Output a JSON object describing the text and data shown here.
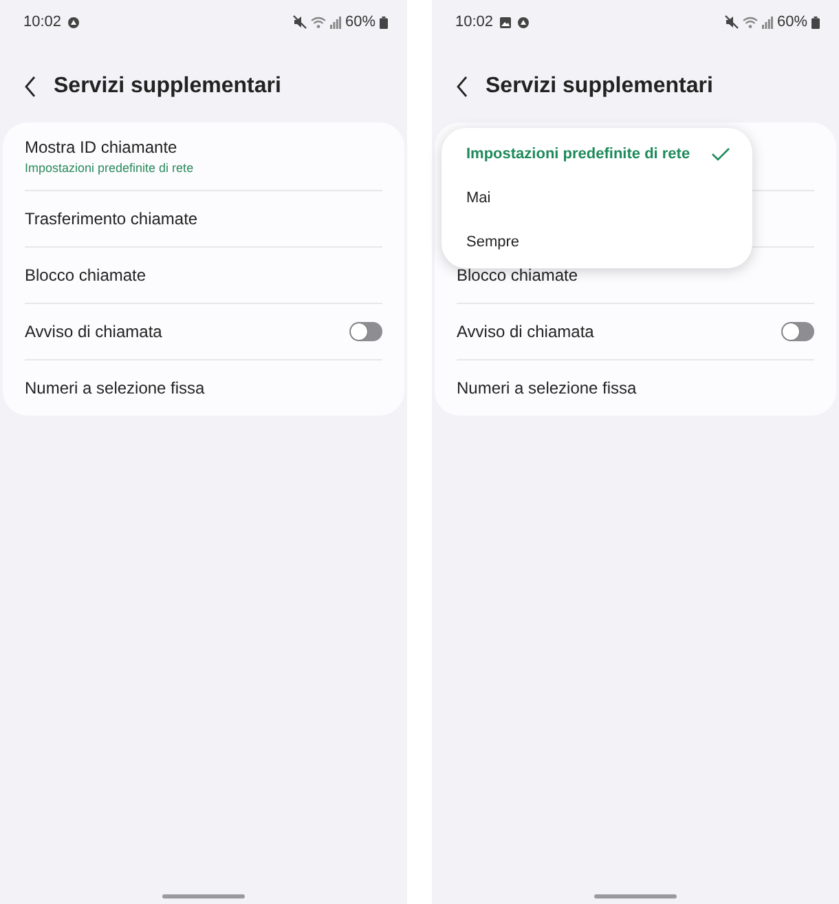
{
  "screens": [
    {
      "status_bar": {
        "time": "10:02",
        "notification_icons": [
          {
            "kind": "badge"
          }
        ],
        "battery": "60%"
      },
      "header": {
        "title": "Servizi supplementari"
      },
      "rows": [
        {
          "kind": "text",
          "label": "Mostra ID chiamante",
          "subtitle": "Impostazioni predefinite di rete"
        },
        {
          "kind": "text",
          "label": "Trasferimento chiamate"
        },
        {
          "kind": "text",
          "label": "Blocco chiamate"
        },
        {
          "kind": "switch",
          "label": "Avviso di chiamata",
          "on": false
        },
        {
          "kind": "text",
          "label": "Numeri a selezione fissa"
        }
      ]
    },
    {
      "status_bar": {
        "time": "10:02",
        "notification_icons": [
          {
            "kind": "image"
          },
          {
            "kind": "badge"
          }
        ],
        "battery": "60%"
      },
      "header": {
        "title": "Servizi supplementari"
      },
      "rows": [
        {
          "kind": "covered",
          "tall": true
        },
        {
          "kind": "covered"
        },
        {
          "kind": "text",
          "label": "Blocco chiamate"
        },
        {
          "kind": "switch",
          "label": "Avviso di chiamata",
          "on": false
        },
        {
          "kind": "text",
          "label": "Numeri a selezione fissa"
        }
      ],
      "menu": {
        "options": [
          {
            "label": "Impostazioni predefinite di rete",
            "selected": true
          },
          {
            "label": "Mai",
            "selected": false
          },
          {
            "label": "Sempre",
            "selected": false
          }
        ]
      }
    }
  ]
}
